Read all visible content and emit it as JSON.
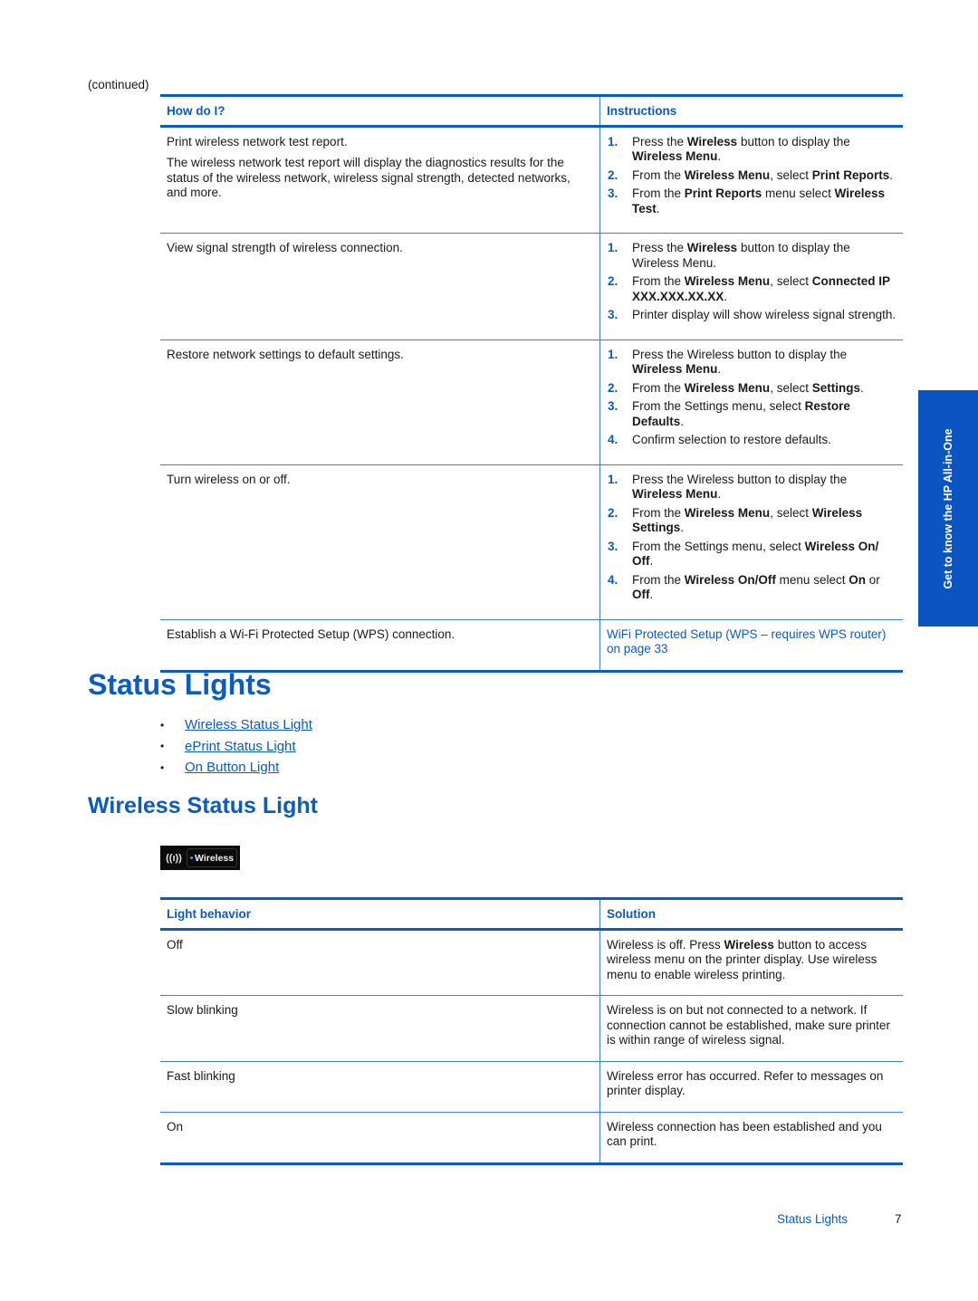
{
  "continued_label": "(continued)",
  "table1": {
    "headers": [
      "How do I?",
      "Instructions"
    ],
    "rows": [
      {
        "question": "Print wireless network test report.",
        "note": "The wireless network test report will display the diagnostics results for the status of the wireless network, wireless signal strength, detected networks, and more.",
        "steps": [
          {
            "num": "1.",
            "parts": [
              [
                "Press the ",
                false
              ],
              [
                "Wireless",
                true
              ],
              [
                " button to display the ",
                false
              ],
              [
                "Wireless Menu",
                true
              ],
              [
                ".",
                false
              ]
            ]
          },
          {
            "num": "2.",
            "parts": [
              [
                "From the ",
                false
              ],
              [
                "Wireless Menu",
                true
              ],
              [
                ", select ",
                false
              ],
              [
                "Print Reports",
                true
              ],
              [
                ".",
                false
              ]
            ]
          },
          {
            "num": "3.",
            "parts": [
              [
                "From the ",
                false
              ],
              [
                "Print Reports",
                true
              ],
              [
                " menu select ",
                false
              ],
              [
                "Wireless Test",
                true
              ],
              [
                ".",
                false
              ]
            ]
          }
        ]
      },
      {
        "question": "View signal strength of wireless connection.",
        "steps": [
          {
            "num": "1.",
            "parts": [
              [
                "Press the ",
                false
              ],
              [
                "Wireless",
                true
              ],
              [
                " button to display the Wireless Menu.",
                false
              ]
            ]
          },
          {
            "num": "2.",
            "parts": [
              [
                "From the ",
                false
              ],
              [
                "Wireless Menu",
                true
              ],
              [
                ", select ",
                false
              ],
              [
                "Connected IP XXX.XXX.XX.XX",
                true
              ],
              [
                ".",
                false
              ]
            ]
          },
          {
            "num": "3.",
            "parts": [
              [
                "Printer display will show wireless signal strength.",
                false
              ]
            ]
          }
        ]
      },
      {
        "question": "Restore network settings to default settings.",
        "steps": [
          {
            "num": "1.",
            "parts": [
              [
                "Press the Wireless button to display the ",
                false
              ],
              [
                "Wireless Menu",
                true
              ],
              [
                ".",
                false
              ]
            ]
          },
          {
            "num": "2.",
            "parts": [
              [
                "From the ",
                false
              ],
              [
                "Wireless Menu",
                true
              ],
              [
                ", select ",
                false
              ],
              [
                "Settings",
                true
              ],
              [
                ".",
                false
              ]
            ]
          },
          {
            "num": "3.",
            "parts": [
              [
                "From the Settings menu, select ",
                false
              ],
              [
                "Restore Defaults",
                true
              ],
              [
                ".",
                false
              ]
            ]
          },
          {
            "num": "4.",
            "parts": [
              [
                "Confirm selection to restore defaults.",
                false
              ]
            ]
          }
        ]
      },
      {
        "question": "Turn wireless on or off.",
        "steps": [
          {
            "num": "1.",
            "parts": [
              [
                "Press the Wireless button to display the ",
                false
              ],
              [
                "Wireless Menu",
                true
              ],
              [
                ".",
                false
              ]
            ]
          },
          {
            "num": "2.",
            "parts": [
              [
                "From the ",
                false
              ],
              [
                "Wireless Menu",
                true
              ],
              [
                ", select ",
                false
              ],
              [
                "Wireless Settings",
                true
              ],
              [
                ".",
                false
              ]
            ]
          },
          {
            "num": "3.",
            "parts": [
              [
                "From the Settings menu, select ",
                false
              ],
              [
                "Wireless On/ Off",
                true
              ],
              [
                ".",
                false
              ]
            ]
          },
          {
            "num": "4.",
            "parts": [
              [
                "From the ",
                false
              ],
              [
                "Wireless On/Off",
                true
              ],
              [
                " menu select ",
                false
              ],
              [
                "On",
                true
              ],
              [
                " or ",
                false
              ],
              [
                "Off",
                true
              ],
              [
                ".",
                false
              ]
            ]
          }
        ]
      },
      {
        "question": "Establish a Wi-Fi Protected Setup (WPS) connection.",
        "link": "WiFi Protected Setup (WPS – requires WPS router) on page 33"
      }
    ]
  },
  "section_title": "Status Lights",
  "toc": [
    "Wireless Status Light",
    "ePrint Status Light",
    "On Button Light"
  ],
  "subsection_title": "Wireless Status Light",
  "wireless_image": {
    "icon": "wireless-antenna-icon",
    "antenna_glyph": "((ı))",
    "label": "Wireless",
    "indicator_color": "#3aa0ff"
  },
  "table2": {
    "headers": [
      "Light behavior",
      "Solution"
    ],
    "rows": [
      {
        "behavior": "Off",
        "solution": [
          [
            "Wireless is off. Press ",
            false
          ],
          [
            "Wireless",
            true
          ],
          [
            " button to access wireless menu on the printer display. Use wireless menu to enable wireless printing.",
            false
          ]
        ]
      },
      {
        "behavior": "Slow blinking",
        "solution": [
          [
            "Wireless is on but not connected to a network. If connection cannot be established, make sure printer is within range of wireless signal.",
            false
          ]
        ]
      },
      {
        "behavior": "Fast blinking",
        "solution": [
          [
            "Wireless error has occurred. Refer to messages on printer display.",
            false
          ]
        ]
      },
      {
        "behavior": "On",
        "solution": [
          [
            "Wireless connection has been established and you can print.",
            false
          ]
        ]
      }
    ]
  },
  "side_tab": "Get to know the HP All-in-One",
  "footer": {
    "section": "Status Lights",
    "page": "7"
  },
  "colors": {
    "accent": "#0a5bc4",
    "side_tab": "#0a55c2",
    "text": "#1a1a1a"
  }
}
